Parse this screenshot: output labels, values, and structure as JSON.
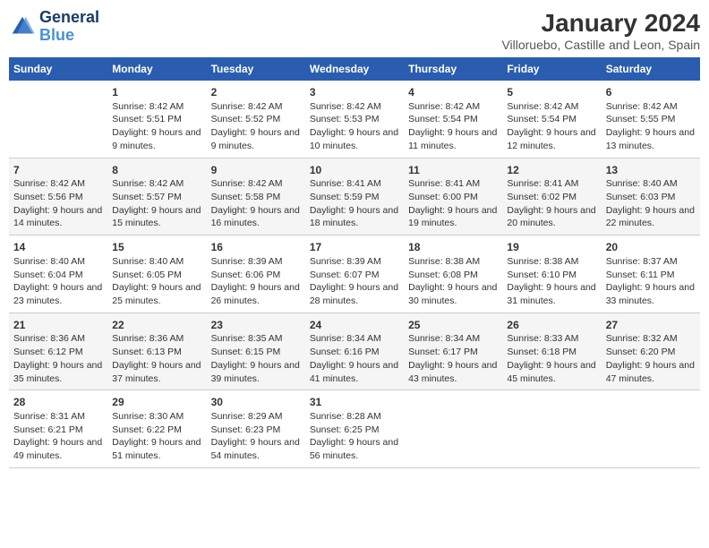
{
  "header": {
    "logo_line1": "General",
    "logo_line2": "Blue",
    "main_title": "January 2024",
    "subtitle": "Villoruebo, Castille and Leon, Spain"
  },
  "columns": [
    "Sunday",
    "Monday",
    "Tuesday",
    "Wednesday",
    "Thursday",
    "Friday",
    "Saturday"
  ],
  "weeks": [
    [
      {
        "day": "",
        "sunrise": "",
        "sunset": "",
        "daylight": ""
      },
      {
        "day": "1",
        "sunrise": "Sunrise: 8:42 AM",
        "sunset": "Sunset: 5:51 PM",
        "daylight": "Daylight: 9 hours and 9 minutes."
      },
      {
        "day": "2",
        "sunrise": "Sunrise: 8:42 AM",
        "sunset": "Sunset: 5:52 PM",
        "daylight": "Daylight: 9 hours and 9 minutes."
      },
      {
        "day": "3",
        "sunrise": "Sunrise: 8:42 AM",
        "sunset": "Sunset: 5:53 PM",
        "daylight": "Daylight: 9 hours and 10 minutes."
      },
      {
        "day": "4",
        "sunrise": "Sunrise: 8:42 AM",
        "sunset": "Sunset: 5:54 PM",
        "daylight": "Daylight: 9 hours and 11 minutes."
      },
      {
        "day": "5",
        "sunrise": "Sunrise: 8:42 AM",
        "sunset": "Sunset: 5:54 PM",
        "daylight": "Daylight: 9 hours and 12 minutes."
      },
      {
        "day": "6",
        "sunrise": "Sunrise: 8:42 AM",
        "sunset": "Sunset: 5:55 PM",
        "daylight": "Daylight: 9 hours and 13 minutes."
      }
    ],
    [
      {
        "day": "7",
        "sunrise": "Sunrise: 8:42 AM",
        "sunset": "Sunset: 5:56 PM",
        "daylight": "Daylight: 9 hours and 14 minutes."
      },
      {
        "day": "8",
        "sunrise": "Sunrise: 8:42 AM",
        "sunset": "Sunset: 5:57 PM",
        "daylight": "Daylight: 9 hours and 15 minutes."
      },
      {
        "day": "9",
        "sunrise": "Sunrise: 8:42 AM",
        "sunset": "Sunset: 5:58 PM",
        "daylight": "Daylight: 9 hours and 16 minutes."
      },
      {
        "day": "10",
        "sunrise": "Sunrise: 8:41 AM",
        "sunset": "Sunset: 5:59 PM",
        "daylight": "Daylight: 9 hours and 18 minutes."
      },
      {
        "day": "11",
        "sunrise": "Sunrise: 8:41 AM",
        "sunset": "Sunset: 6:00 PM",
        "daylight": "Daylight: 9 hours and 19 minutes."
      },
      {
        "day": "12",
        "sunrise": "Sunrise: 8:41 AM",
        "sunset": "Sunset: 6:02 PM",
        "daylight": "Daylight: 9 hours and 20 minutes."
      },
      {
        "day": "13",
        "sunrise": "Sunrise: 8:40 AM",
        "sunset": "Sunset: 6:03 PM",
        "daylight": "Daylight: 9 hours and 22 minutes."
      }
    ],
    [
      {
        "day": "14",
        "sunrise": "Sunrise: 8:40 AM",
        "sunset": "Sunset: 6:04 PM",
        "daylight": "Daylight: 9 hours and 23 minutes."
      },
      {
        "day": "15",
        "sunrise": "Sunrise: 8:40 AM",
        "sunset": "Sunset: 6:05 PM",
        "daylight": "Daylight: 9 hours and 25 minutes."
      },
      {
        "day": "16",
        "sunrise": "Sunrise: 8:39 AM",
        "sunset": "Sunset: 6:06 PM",
        "daylight": "Daylight: 9 hours and 26 minutes."
      },
      {
        "day": "17",
        "sunrise": "Sunrise: 8:39 AM",
        "sunset": "Sunset: 6:07 PM",
        "daylight": "Daylight: 9 hours and 28 minutes."
      },
      {
        "day": "18",
        "sunrise": "Sunrise: 8:38 AM",
        "sunset": "Sunset: 6:08 PM",
        "daylight": "Daylight: 9 hours and 30 minutes."
      },
      {
        "day": "19",
        "sunrise": "Sunrise: 8:38 AM",
        "sunset": "Sunset: 6:10 PM",
        "daylight": "Daylight: 9 hours and 31 minutes."
      },
      {
        "day": "20",
        "sunrise": "Sunrise: 8:37 AM",
        "sunset": "Sunset: 6:11 PM",
        "daylight": "Daylight: 9 hours and 33 minutes."
      }
    ],
    [
      {
        "day": "21",
        "sunrise": "Sunrise: 8:36 AM",
        "sunset": "Sunset: 6:12 PM",
        "daylight": "Daylight: 9 hours and 35 minutes."
      },
      {
        "day": "22",
        "sunrise": "Sunrise: 8:36 AM",
        "sunset": "Sunset: 6:13 PM",
        "daylight": "Daylight: 9 hours and 37 minutes."
      },
      {
        "day": "23",
        "sunrise": "Sunrise: 8:35 AM",
        "sunset": "Sunset: 6:15 PM",
        "daylight": "Daylight: 9 hours and 39 minutes."
      },
      {
        "day": "24",
        "sunrise": "Sunrise: 8:34 AM",
        "sunset": "Sunset: 6:16 PM",
        "daylight": "Daylight: 9 hours and 41 minutes."
      },
      {
        "day": "25",
        "sunrise": "Sunrise: 8:34 AM",
        "sunset": "Sunset: 6:17 PM",
        "daylight": "Daylight: 9 hours and 43 minutes."
      },
      {
        "day": "26",
        "sunrise": "Sunrise: 8:33 AM",
        "sunset": "Sunset: 6:18 PM",
        "daylight": "Daylight: 9 hours and 45 minutes."
      },
      {
        "day": "27",
        "sunrise": "Sunrise: 8:32 AM",
        "sunset": "Sunset: 6:20 PM",
        "daylight": "Daylight: 9 hours and 47 minutes."
      }
    ],
    [
      {
        "day": "28",
        "sunrise": "Sunrise: 8:31 AM",
        "sunset": "Sunset: 6:21 PM",
        "daylight": "Daylight: 9 hours and 49 minutes."
      },
      {
        "day": "29",
        "sunrise": "Sunrise: 8:30 AM",
        "sunset": "Sunset: 6:22 PM",
        "daylight": "Daylight: 9 hours and 51 minutes."
      },
      {
        "day": "30",
        "sunrise": "Sunrise: 8:29 AM",
        "sunset": "Sunset: 6:23 PM",
        "daylight": "Daylight: 9 hours and 54 minutes."
      },
      {
        "day": "31",
        "sunrise": "Sunrise: 8:28 AM",
        "sunset": "Sunset: 6:25 PM",
        "daylight": "Daylight: 9 hours and 56 minutes."
      },
      {
        "day": "",
        "sunrise": "",
        "sunset": "",
        "daylight": ""
      },
      {
        "day": "",
        "sunrise": "",
        "sunset": "",
        "daylight": ""
      },
      {
        "day": "",
        "sunrise": "",
        "sunset": "",
        "daylight": ""
      }
    ]
  ]
}
